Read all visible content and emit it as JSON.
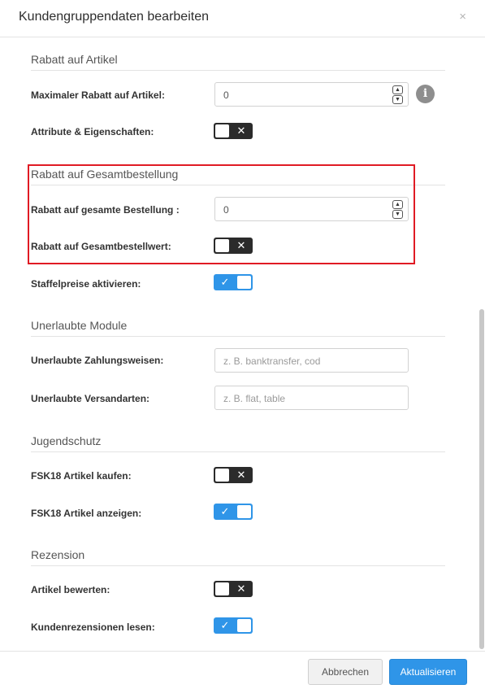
{
  "dialog": {
    "title": "Kundengruppendaten bearbeiten",
    "close_glyph": "×"
  },
  "sections": {
    "rabatt_artikel": "Rabatt auf Artikel",
    "rabatt_gesamt": "Rabatt auf Gesamtbestellung",
    "unerlaubte_module": "Unerlaubte Module",
    "jugendschutz": "Jugendschutz",
    "rezension": "Rezension"
  },
  "fields": {
    "max_rabatt": {
      "label": "Maximaler Rabatt auf Artikel:",
      "value": "0"
    },
    "attribute": {
      "label": "Attribute & Eigenschaften:",
      "state": "off"
    },
    "rabatt_gesamt_bestellung": {
      "label": "Rabatt auf gesamte Bestellung :",
      "value": "0"
    },
    "rabatt_gesamtbestellwert": {
      "label": "Rabatt auf Gesamtbestellwert:",
      "state": "off"
    },
    "staffelpreise": {
      "label": "Staffelpreise aktivieren:",
      "state": "on"
    },
    "zahlungsweisen": {
      "label": "Unerlaubte Zahlungsweisen:",
      "value": "",
      "placeholder": "z. B. banktransfer, cod"
    },
    "versandarten": {
      "label": "Unerlaubte Versandarten:",
      "value": "",
      "placeholder": "z. B. flat, table"
    },
    "fsk18_kaufen": {
      "label": "FSK18 Artikel kaufen:",
      "state": "off"
    },
    "fsk18_anzeigen": {
      "label": "FSK18 Artikel anzeigen:",
      "state": "on"
    },
    "artikel_bewerten": {
      "label": "Artikel bewerten:",
      "state": "off"
    },
    "rezensionen_lesen": {
      "label": "Kundenrezensionen lesen:",
      "state": "on"
    }
  },
  "glyphs": {
    "toggle_off": "✕",
    "toggle_on": "✓",
    "info": "i",
    "spin_up": "▲",
    "spin_down": "▼"
  },
  "colors": {
    "accent": "#2f95e8",
    "toggle_off": "#2b2b2b",
    "highlight": "#e01b24"
  },
  "footer": {
    "cancel_label": "Abbrechen",
    "submit_label": "Aktualisieren"
  }
}
